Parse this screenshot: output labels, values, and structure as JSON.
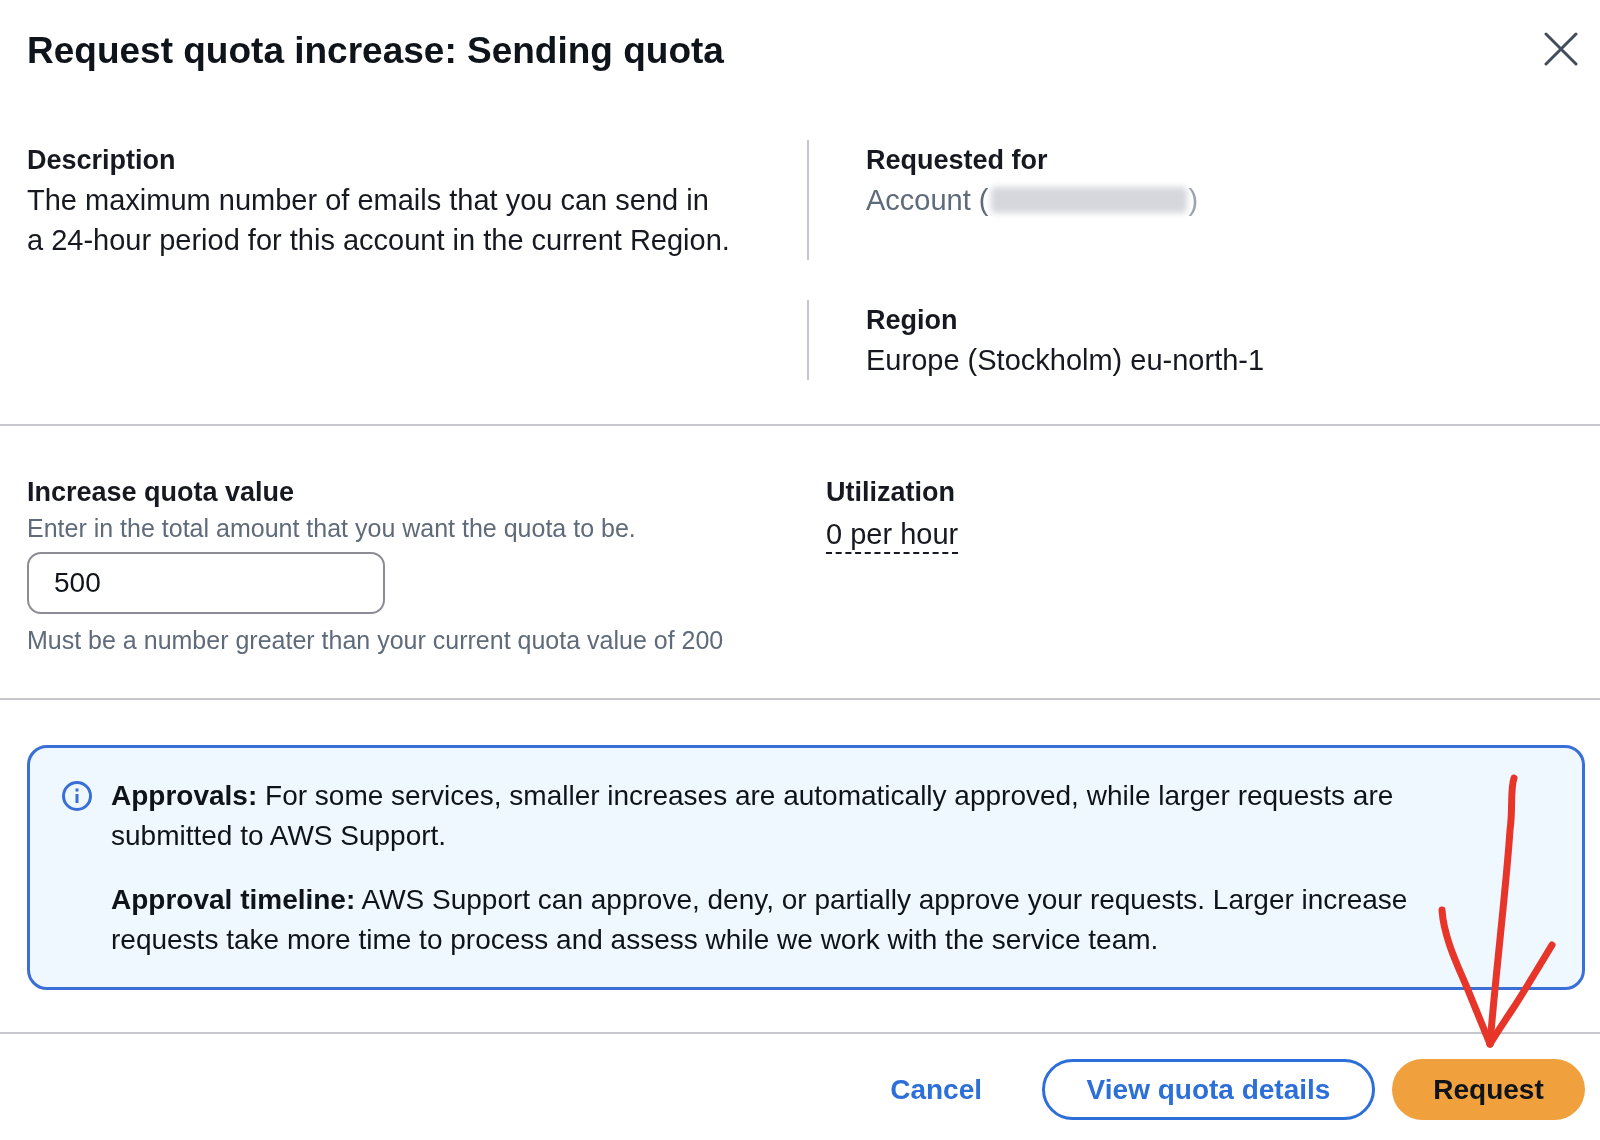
{
  "dialog": {
    "title": "Request quota increase: Sending quota"
  },
  "details": {
    "description": {
      "label": "Description",
      "text": "The maximum number of emails that you can send in a 24-hour period for this account in the current Region."
    },
    "fields": [
      {
        "label": "Requested for",
        "value": "Account (",
        "redacted": true,
        "value_end": ")",
        "muted": true
      },
      {
        "label": "Region",
        "value": "Europe (Stockholm) eu-north-1",
        "redacted": false,
        "muted": false
      }
    ]
  },
  "quota": {
    "label": "Increase quota value",
    "hint": "Enter in the total amount that you want the quota to be.",
    "value": "500",
    "constraint": "Must be a number greater than your current quota value of 200"
  },
  "utilization": {
    "label": "Utilization",
    "value": "0 per hour"
  },
  "alert": {
    "kind": "info",
    "paragraphs": [
      "**Approvals:** For some services, smaller increases are automatically approved, while larger requests are submitted to AWS Support.",
      "**Approval timeline:** AWS Support can approve, deny, or partially approve your requests. Larger increase requests take more time to process and assess while we work with the service team."
    ]
  },
  "footer": {
    "buttons": [
      {
        "label": "Cancel",
        "kind": "link"
      },
      {
        "label": "View quota details",
        "kind": "secondary"
      },
      {
        "label": "Request",
        "kind": "primary"
      }
    ]
  },
  "annotations": [
    {
      "kind": "arrow"
    }
  ]
}
